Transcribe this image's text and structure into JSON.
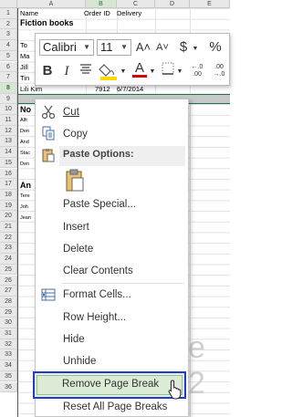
{
  "sheet": {
    "columns": [
      "A",
      "B",
      "C",
      "D",
      "E"
    ],
    "rows": [
      "1",
      "2",
      "3",
      "4",
      "5",
      "6",
      "7",
      "8",
      "9",
      "10",
      "11",
      "12",
      "13",
      "14",
      "15",
      "16",
      "17",
      "18",
      "19",
      "20",
      "21",
      "22",
      "23",
      "24",
      "25",
      "26",
      "27",
      "28",
      "29",
      "30",
      "31",
      "32",
      "33",
      "34",
      "35",
      "36"
    ],
    "header_cells": {
      "a1": "Name",
      "b1": "Order ID",
      "c1": "Delivery"
    },
    "title_cell": "Fiction books",
    "partial_cells": [
      "To",
      "Ma",
      "Jill",
      "Tin"
    ],
    "row7": {
      "a": "Lili Kim",
      "b": "7912",
      "c": "6/7/2014"
    },
    "lower_labels": [
      "No",
      "Alfr",
      "Den",
      "And",
      "Stac",
      "Den"
    ],
    "lower_title": "An",
    "lower_small": [
      "Tere",
      "Joh",
      "Jean"
    ],
    "watermark": "e 2"
  },
  "mini_toolbar": {
    "font_name": "Calibri",
    "font_size": "11",
    "grow_font": "A˄",
    "shrink_font": "A˅",
    "currency": "$",
    "percent": "%",
    "bold": "B",
    "italic": "I",
    "font_color_label": "A",
    "increase_decimal": "←.0\n.00",
    "decrease_decimal": ".00\n→.0"
  },
  "menu": {
    "cut": "Cut",
    "copy": "Copy",
    "paste_options": "Paste Options:",
    "paste_special": "Paste Special...",
    "insert": "Insert",
    "delete": "Delete",
    "clear_contents": "Clear Contents",
    "format_cells": "Format Cells...",
    "row_height": "Row Height...",
    "hide": "Hide",
    "unhide": "Unhide",
    "remove_page_break": "Remove Page Break",
    "reset_all_page_breaks": "Reset All Page Breaks"
  },
  "colors": {
    "accent": "#217346",
    "highlight_border": "#1e3ccf",
    "page_break": "#2d5db8"
  },
  "icons": [
    "cut-icon",
    "copy-icon",
    "paste-icon",
    "format-cells-icon",
    "mouse-cursor-icon"
  ]
}
